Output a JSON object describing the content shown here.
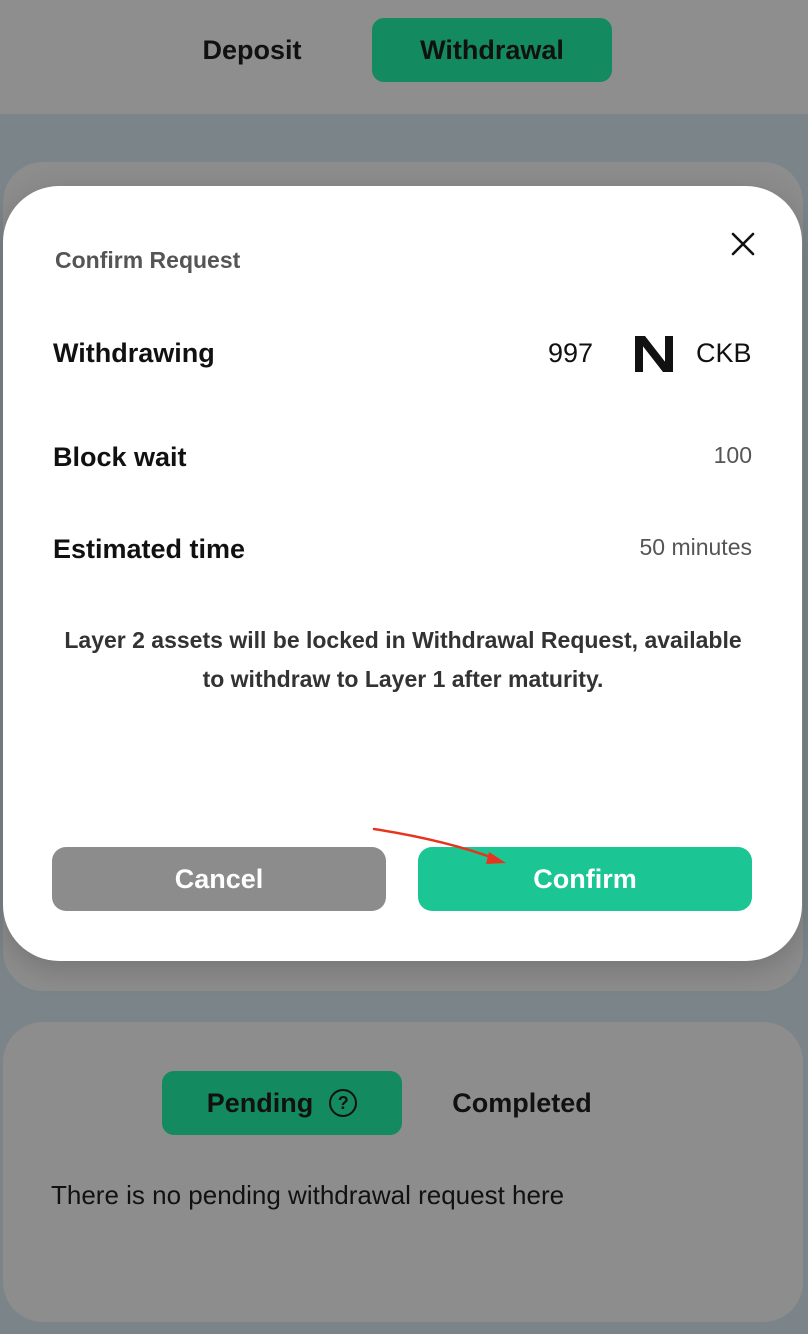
{
  "tabs": {
    "deposit": "Deposit",
    "withdrawal": "Withdrawal",
    "active": "withdrawal"
  },
  "modal": {
    "title": "Confirm Request",
    "withdrawing_label": "Withdrawing",
    "amount": "997",
    "token": "CKB",
    "token_icon": "nervos-logo-icon",
    "block_wait_label": "Block wait",
    "block_wait_value": "100",
    "estimated_time_label": "Estimated time",
    "estimated_time_value": "50 minutes",
    "note": "Layer 2 assets will be locked in Withdrawal Request, available to withdraw to Layer 1 after maturity.",
    "cancel_label": "Cancel",
    "confirm_label": "Confirm"
  },
  "requests": {
    "pending_label": "Pending",
    "completed_label": "Completed",
    "empty_message": "There is no pending withdrawal request here"
  },
  "colors": {
    "accent": "#1cc694",
    "accent_dimmed": "#138a60",
    "cancel": "#8c8c8c",
    "annotation_arrow": "#e8331f"
  }
}
